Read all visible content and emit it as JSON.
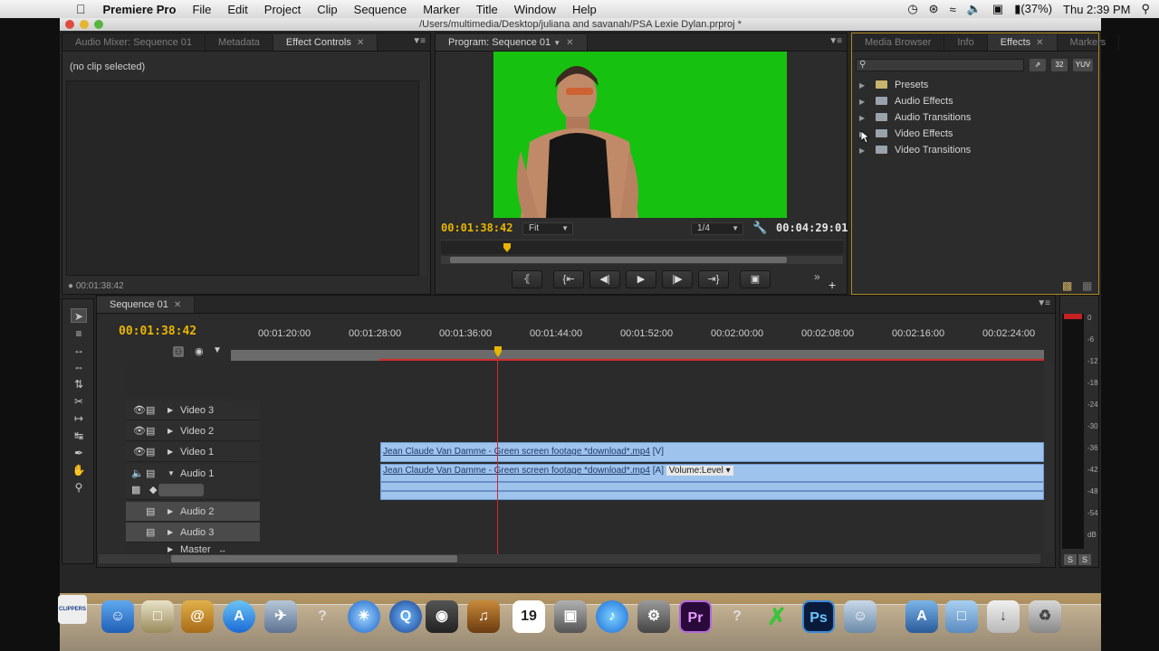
{
  "menubar": {
    "app_name": "Premiere Pro",
    "items": [
      "File",
      "Edit",
      "Project",
      "Clip",
      "Sequence",
      "Marker",
      "Title",
      "Window",
      "Help"
    ],
    "battery": "(37%)",
    "clock": "Thu 2:39 PM"
  },
  "window": {
    "title": "/Users/multimedia/Desktop/juliana and savanah/PSA Lexie Dylan.prproj *"
  },
  "source_panel": {
    "tabs": [
      "Audio Mixer: Sequence 01",
      "Metadata",
      "Effect Controls"
    ],
    "active_tab": "Effect Controls",
    "no_clip": "(no clip selected)",
    "timecode": "00:01:38:42"
  },
  "program_monitor": {
    "tab": "Program: Sequence 01",
    "current_timecode": "00:01:38:42",
    "duration_timecode": "00:04:29:01",
    "fit_value": "Fit",
    "resolution_value": "1/4",
    "playhead_fraction": 0.165
  },
  "effects_panel": {
    "tabs": [
      "Media Browser",
      "Info",
      "Effects",
      "Markers"
    ],
    "active_tab": "Effects",
    "search_placeholder": "",
    "filter_buttons": [
      "32",
      "YUV"
    ],
    "items": [
      {
        "label": "Presets",
        "icon": "preset-folder-icon"
      },
      {
        "label": "Audio Effects",
        "icon": "folder-icon"
      },
      {
        "label": "Audio Transitions",
        "icon": "folder-icon"
      },
      {
        "label": "Video Effects",
        "icon": "folder-icon"
      },
      {
        "label": "Video Transitions",
        "icon": "folder-icon"
      }
    ]
  },
  "timeline": {
    "tab": "Sequence 01",
    "timecode": "00:01:38:42",
    "ruler_labels": [
      "00:01:20:00",
      "00:01:28:00",
      "00:01:36:00",
      "00:01:44:00",
      "00:01:52:00",
      "00:02:00:00",
      "00:02:08:00",
      "00:02:16:00",
      "00:02:24:00"
    ],
    "tracks": {
      "video": [
        "Video 3",
        "Video 2",
        "Video 1"
      ],
      "audio": [
        "Audio 1",
        "Audio 2",
        "Audio 3"
      ],
      "master": "Master"
    },
    "clip_video": {
      "name": "Jean Claude Van Damme - Green screen footage *download*.mp4",
      "suffix": "[V]"
    },
    "clip_audio": {
      "name": "Jean Claude Van Damme - Green screen footage *download*.mp4",
      "suffix": "[A]",
      "volume": "Volume:Level"
    }
  },
  "audio_meter": {
    "labels": [
      "0",
      "-6",
      "-12",
      "-18",
      "-24",
      "-30",
      "-36",
      "-42",
      "-48",
      "-54",
      "dB"
    ],
    "solo_buttons": [
      "S",
      "S"
    ]
  },
  "dock": {
    "premiere_label": "Pr",
    "photoshop_label": "Ps",
    "calendar_day": "19",
    "clippers_label": "CLIPPERS"
  },
  "colors": {
    "timecode_accent": "#e8b600",
    "clip_blue": "#9ec3ec",
    "green_screen": "#17c10f",
    "playhead": "#d42a2a"
  }
}
